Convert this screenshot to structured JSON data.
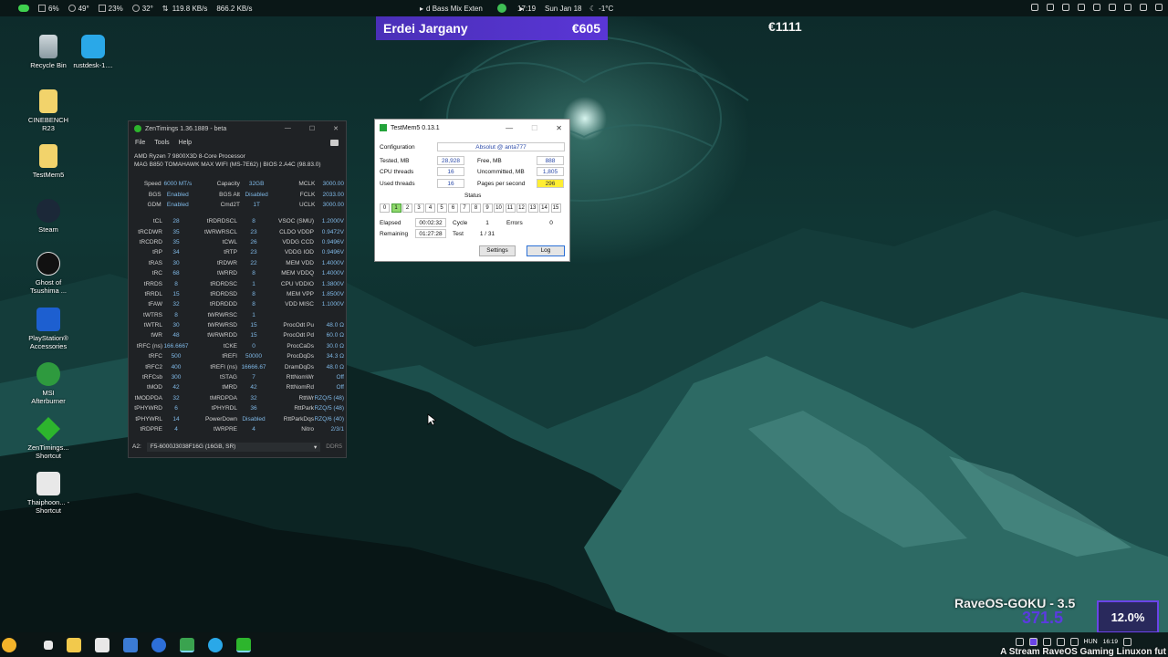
{
  "topbar": {
    "items": [
      "6%",
      "49°",
      "23%",
      "32°",
      "119.8 KB/s",
      "866.2 KB/s"
    ],
    "media": "d Bass Mix Exten",
    "time": "17:19",
    "date": "Sun Jan 18",
    "weather": "-1°C"
  },
  "banner": {
    "name": "Erdei Jargany",
    "amount": "€605",
    "total": "€1111"
  },
  "desktop_icons": [
    {
      "label": "Recycle Bin"
    },
    {
      "label": "rustdesk-1...."
    },
    {
      "label": "CINEBENCH R23"
    },
    {
      "label": "TestMem5"
    },
    {
      "label": "Steam"
    },
    {
      "label": "Ghost of Tsushima ..."
    },
    {
      "label": "PlayStation® Accessories"
    },
    {
      "label": "MSI Afterburner"
    },
    {
      "label": "ZenTimings... Shortcut"
    },
    {
      "label": "Thaiphoon... - Shortcut"
    }
  ],
  "zentimings": {
    "title": "ZenTimings 1.36.1889 - beta",
    "menu": [
      "File",
      "Tools",
      "Help"
    ],
    "cpu_line1": "AMD Ryzen 7 9800X3D 8-Core Processor",
    "cpu_line2": "MAG B850 TOMAHAWK MAX WIFI (MS-7E62) | BIOS 2.A4C (98.83.0)",
    "top_rows": [
      [
        "Speed",
        "6000 MT/s",
        "Capacity",
        "32GB",
        "MCLK",
        "3000.00"
      ],
      [
        "BGS",
        "Enabled",
        "BGS Alt",
        "Disabled",
        "FCLK",
        "2033.00"
      ],
      [
        "GDM",
        "Enabled",
        "Cmd2T",
        "1T",
        "UCLK",
        "3000.00"
      ]
    ],
    "rows": [
      [
        "tCL",
        "28",
        "tRDRDSCL",
        "8",
        "VSOC (SMU)",
        "1.2000V"
      ],
      [
        "tRCDWR",
        "35",
        "tWRWRSCL",
        "23",
        "CLDO VDDP",
        "0.9472V"
      ],
      [
        "tRCDRD",
        "35",
        "tCWL",
        "26",
        "VDDG CCD",
        "0.9496V"
      ],
      [
        "tRP",
        "34",
        "tRTP",
        "23",
        "VDDG IOD",
        "0.9496V"
      ],
      [
        "tRAS",
        "30",
        "tRDWR",
        "22",
        "MEM VDD",
        "1.4000V"
      ],
      [
        "tRC",
        "68",
        "tWRRD",
        "8",
        "MEM VDDQ",
        "1.4000V"
      ],
      [
        "tRRDS",
        "8",
        "tRDRDSC",
        "1",
        "CPU VDDIO",
        "1.3800V"
      ],
      [
        "tRRDL",
        "15",
        "tRDRDSD",
        "8",
        "MEM VPP",
        "1.8500V"
      ],
      [
        "tFAW",
        "32",
        "tRDRDDD",
        "8",
        "VDD MISC",
        "1.1000V"
      ],
      [
        "tWTRS",
        "8",
        "tWRWRSC",
        "1",
        "",
        ""
      ],
      [
        "tWTRL",
        "30",
        "tWRWRSD",
        "15",
        "ProcOdt Pu",
        "48.0 Ω"
      ],
      [
        "tWR",
        "48",
        "tWRWRDD",
        "15",
        "ProcOdt Pd",
        "60.0 Ω"
      ],
      [
        "tRFC (ns)",
        "166.6667",
        "tCKE",
        "0",
        "ProcCaDs",
        "30.0 Ω"
      ],
      [
        "tRFC",
        "500",
        "tREFI",
        "50000",
        "ProcDqDs",
        "34.3 Ω"
      ],
      [
        "tRFC2",
        "400",
        "tREFI (ns)",
        "16666.67",
        "DramDqDs",
        "48.0 Ω"
      ],
      [
        "tRFCsb",
        "300",
        "tSTAG",
        "7",
        "RttNomWr",
        "Off"
      ],
      [
        "tMOD",
        "42",
        "tMRD",
        "42",
        "RttNomRd",
        "Off"
      ],
      [
        "tMODPDA",
        "32",
        "tMRDPDA",
        "32",
        "RttWr",
        "RZQ/5 (48)"
      ],
      [
        "tPHYWRD",
        "6",
        "tPHYRDL",
        "36",
        "RttPark",
        "RZQ/5 (48)"
      ],
      [
        "tPHYWRL",
        "14",
        "PowerDown",
        "Disabled",
        "RttParkDqs",
        "RZQ/6 (40)"
      ],
      [
        "tRDPRE",
        "4",
        "tWRPRE",
        "4",
        "Nitro",
        "2/3/1"
      ]
    ],
    "footer_slot": "A2:",
    "footer_module": "F5-6000J3038F16G (16GB, SR)",
    "footer_type": "DDR5"
  },
  "testmem": {
    "title": "TestMem5  0.13.1",
    "config_label": "Configuration",
    "config_value": "Absolut @ anta777",
    "tested_label": "Tested, MB",
    "tested_value": "28,928",
    "free_label": "Free, MB",
    "free_value": "888",
    "cpu_threads_label": "CPU threads",
    "cpu_threads_value": "16",
    "uncommitted_label": "Uncommitted, MB",
    "uncommitted_value": "1,805",
    "used_threads_label": "Used threads",
    "used_threads_value": "16",
    "pps_label": "Pages per second",
    "pps_value": "296",
    "status_label": "Status",
    "cells": [
      "0",
      "1",
      "2",
      "3",
      "4",
      "5",
      "6",
      "7",
      "8",
      "9",
      "10",
      "11",
      "12",
      "13",
      "14",
      "15"
    ],
    "active_cell": 1,
    "elapsed_label": "Elapsed",
    "elapsed_value": "00:02:32",
    "cycle_label": "Cycle",
    "cycle_value": "1",
    "errors_label": "Errors",
    "errors_value": "0",
    "remaining_label": "Remaining",
    "remaining_value": "01:27:28",
    "test_label": "Test",
    "test_value": "1 / 31",
    "settings_btn": "Settings",
    "log_btn": "Log"
  },
  "rave": {
    "title": "RaveOS-GOKU - 3.5",
    "value": "371.5",
    "percent": "12.0%"
  },
  "taskbar": {
    "lang": "HUN",
    "time": "16:19"
  },
  "stream_text": "A Stream RaveOS Gaming Linuxon fut"
}
